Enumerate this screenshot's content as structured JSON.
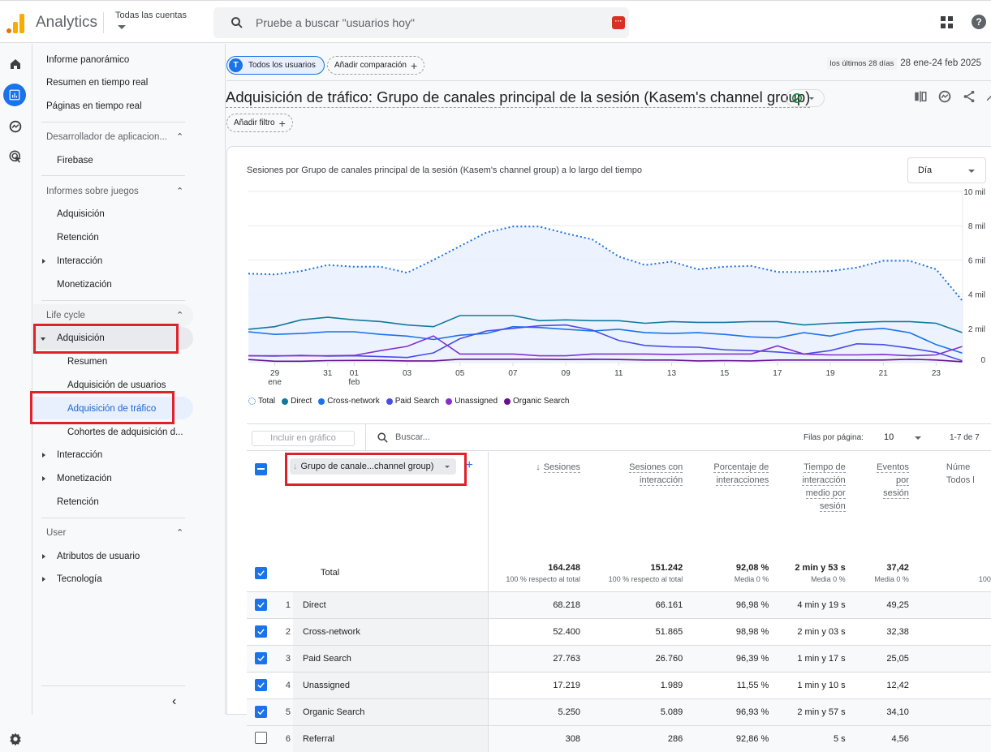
{
  "app": {
    "name": "Analytics",
    "account_label": "Todas las cuentas"
  },
  "search": {
    "placeholder": "Pruebe a buscar \"usuarios hoy\""
  },
  "rail": {
    "icons": [
      "home-icon",
      "reports-icon",
      "explore-icon",
      "advertising-icon"
    ]
  },
  "nav": {
    "top_items": [
      "Informe panorámico",
      "Resumen en tiempo real",
      "Páginas en tiempo real"
    ],
    "sections": [
      {
        "title": "Desarrollador de aplicacion...",
        "items": [
          "Firebase"
        ]
      },
      {
        "title": "Informes sobre juegos",
        "items": [
          "Adquisición",
          "Retención",
          "Interacción",
          "Monetización"
        ]
      },
      {
        "title": "Life cycle",
        "items": [
          "Adquisición",
          "Resumen",
          "Adquisición de usuarios",
          "Adquisición de tráfico",
          "Cohortes de adquisición d...",
          "Interacción",
          "Monetización",
          "Retención"
        ]
      },
      {
        "title": "User",
        "items": [
          "Atributos de usuario",
          "Tecnología"
        ]
      }
    ],
    "active_item": "Adquisición de tráfico"
  },
  "filters": {
    "segment_avatar": "T",
    "segment_label": "Todos los usuarios",
    "add_comparison": "Añadir comparación",
    "add_filter": "Añadir filtro",
    "date_tag": "los últimos 28 días",
    "date_range": "28 ene-24 feb 2025"
  },
  "page_title": "Adquisición de tráfico: Grupo de canales principal de la sesión (Kasem's channel group)",
  "chart_data": {
    "type": "line",
    "title": "Sesiones por Grupo de canales principal de la sesión (Kasem's channel group) a lo largo del tiempo",
    "granularity": "Día",
    "x_ticks": [
      {
        "day": 29,
        "label": "29",
        "sub": "ene"
      },
      {
        "day": 31,
        "label": "31",
        "sub": ""
      },
      {
        "day": 32,
        "label": "01",
        "sub": "feb"
      },
      {
        "day": 34,
        "label": "03",
        "sub": ""
      },
      {
        "day": 36,
        "label": "05",
        "sub": ""
      },
      {
        "day": 38,
        "label": "07",
        "sub": ""
      },
      {
        "day": 40,
        "label": "09",
        "sub": ""
      },
      {
        "day": 42,
        "label": "11",
        "sub": ""
      },
      {
        "day": 44,
        "label": "13",
        "sub": ""
      },
      {
        "day": 46,
        "label": "15",
        "sub": ""
      },
      {
        "day": 48,
        "label": "17",
        "sub": ""
      },
      {
        "day": 50,
        "label": "19",
        "sub": ""
      },
      {
        "day": 52,
        "label": "21",
        "sub": ""
      },
      {
        "day": 54,
        "label": "23",
        "sub": ""
      }
    ],
    "x_range": [
      28,
      55
    ],
    "y_ticks": [
      "0",
      "2 mil",
      "4 mil",
      "6 mil",
      "8 mil",
      "10 mil"
    ],
    "ylim": [
      0,
      10000
    ],
    "grid": true,
    "legend_position": "bottom-left",
    "series": [
      {
        "name": "Total",
        "color": "#1a73e8",
        "dotted": true,
        "values": [
          5200,
          5150,
          5350,
          5700,
          5600,
          5600,
          5250,
          6000,
          6800,
          7600,
          7950,
          7950,
          7550,
          7200,
          6200,
          5700,
          5900,
          5450,
          5600,
          5650,
          5300,
          5300,
          5350,
          5550,
          5950,
          5950,
          5450,
          3600
        ]
      },
      {
        "name": "Direct",
        "color": "#12799e",
        "values": [
          1950,
          2100,
          2500,
          2650,
          2500,
          2400,
          2200,
          2100,
          2750,
          2750,
          2750,
          2450,
          2500,
          2450,
          2450,
          2300,
          2400,
          2350,
          2350,
          2400,
          2400,
          2200,
          2300,
          2350,
          2400,
          2400,
          2300,
          1750
        ]
      },
      {
        "name": "Cross-network",
        "color": "#1a73e8",
        "values": [
          1800,
          1650,
          1700,
          1800,
          1800,
          1650,
          1550,
          1350,
          1600,
          1700,
          2100,
          2050,
          1950,
          1850,
          1950,
          1750,
          1700,
          1750,
          1650,
          1500,
          1450,
          1750,
          1550,
          1900,
          2000,
          1750,
          1050,
          550
        ]
      },
      {
        "name": "Paid Search",
        "color": "#4a4de6",
        "values": [
          400,
          380,
          420,
          380,
          400,
          350,
          300,
          570,
          1400,
          1850,
          2000,
          2150,
          2200,
          1900,
          1300,
          1000,
          920,
          900,
          750,
          700,
          620,
          500,
          700,
          1100,
          1050,
          850,
          600,
          100
        ]
      },
      {
        "name": "Unassigned",
        "color": "#8430ce",
        "values": [
          400,
          400,
          400,
          400,
          420,
          700,
          950,
          1560,
          500,
          500,
          500,
          400,
          400,
          500,
          500,
          500,
          480,
          500,
          500,
          500,
          980,
          500,
          450,
          450,
          480,
          400,
          450,
          950
        ]
      },
      {
        "name": "Organic Search",
        "color": "#6a0f8e",
        "values": [
          180,
          80,
          80,
          120,
          130,
          130,
          100,
          100,
          200,
          200,
          200,
          200,
          180,
          200,
          180,
          150,
          150,
          100,
          120,
          100,
          150,
          150,
          150,
          150,
          150,
          200,
          150,
          50
        ]
      }
    ]
  },
  "table_tools": {
    "include_in_chart": "Incluir en gráfico",
    "search_placeholder": "Buscar...",
    "rows_per_page_label": "Filas por página:",
    "rows_per_page": "10",
    "pagination": "1-7 de 7"
  },
  "table": {
    "dimension_header": "Grupo de canale...channel group)",
    "columns": [
      {
        "label": "Sesiones",
        "lines": [
          "Sesiones"
        ],
        "sorted": true
      },
      {
        "label": "Sesiones con interacción",
        "lines": [
          "Sesiones con",
          "interacción"
        ]
      },
      {
        "label": "Porcentaje de interacciones",
        "lines": [
          "Porcentaje de",
          "interacciones"
        ]
      },
      {
        "label": "Tiempo de interacción medio por sesión",
        "lines": [
          "Tiempo de",
          "interacción",
          "medio por",
          "sesión"
        ]
      },
      {
        "label": "Eventos por sesión",
        "lines": [
          "Eventos",
          "por",
          "sesión"
        ]
      },
      {
        "label": "Núme...",
        "lines": [
          "Núme"
        ],
        "sub": "Todos l"
      }
    ],
    "total": {
      "label": "Total",
      "values": [
        "164.248",
        "151.242",
        "92,08 %",
        "2 min y 53 s",
        "37,42",
        ""
      ],
      "subs": [
        "100 % respecto al total",
        "100 % respecto al total",
        "Media 0 %",
        "Media 0 %",
        "Media 0 %",
        "100"
      ]
    },
    "rows": [
      {
        "rank": "1",
        "name": "Direct",
        "checked": true,
        "values": [
          "68.218",
          "66.161",
          "96,98 %",
          "4 min y 19 s",
          "49,25"
        ]
      },
      {
        "rank": "2",
        "name": "Cross-network",
        "checked": true,
        "values": [
          "52.400",
          "51.865",
          "98,98 %",
          "2 min y 03 s",
          "32,38"
        ]
      },
      {
        "rank": "3",
        "name": "Paid Search",
        "checked": true,
        "values": [
          "27.763",
          "26.760",
          "96,39 %",
          "1 min y 17 s",
          "25,05"
        ]
      },
      {
        "rank": "4",
        "name": "Unassigned",
        "checked": true,
        "values": [
          "17.219",
          "1.989",
          "11,55 %",
          "1 min y 10 s",
          "12,42"
        ]
      },
      {
        "rank": "5",
        "name": "Organic Search",
        "checked": true,
        "values": [
          "5.250",
          "5.089",
          "96,93 %",
          "2 min y 57 s",
          "34,10"
        ]
      },
      {
        "rank": "6",
        "name": "Referral",
        "checked": false,
        "values": [
          "308",
          "286",
          "92,86 %",
          "5 s",
          "4,56"
        ]
      }
    ]
  }
}
